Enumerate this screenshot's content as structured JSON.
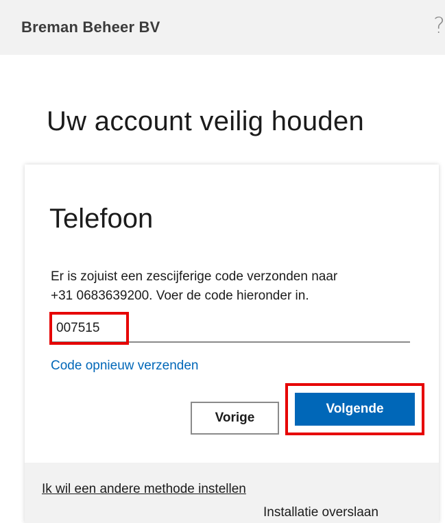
{
  "header": {
    "org_name": "Breman Beheer BV",
    "help_symbol": "?"
  },
  "main": {
    "title": "Uw account veilig houden"
  },
  "card": {
    "title": "Telefoon",
    "description_line1": "Er is zojuist een zescijferige code verzonden naar",
    "description_line2": "+31 0683639200. Voer de code hieronder in.",
    "code_value": "007515",
    "resend_label": "Code opnieuw verzenden",
    "back_label": "Vorige",
    "next_label": "Volgende"
  },
  "footer": {
    "other_method_label": "Ik wil een andere methode instellen",
    "skip_label": "Installatie overslaan"
  },
  "colors": {
    "accent": "#0067b8",
    "highlight": "#e60000",
    "background": "#f2f2f2"
  },
  "icons": {
    "help": "help-icon"
  }
}
